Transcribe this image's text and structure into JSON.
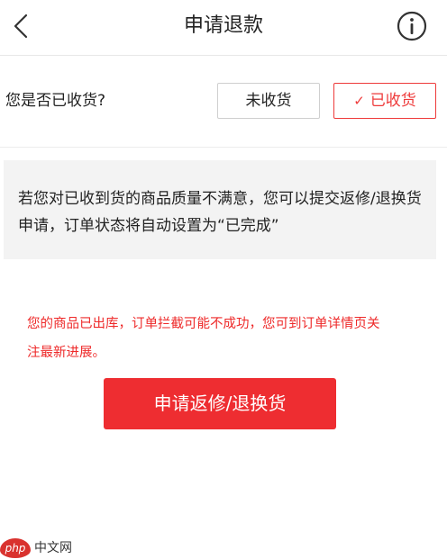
{
  "header": {
    "title": "申请退款"
  },
  "receipt": {
    "question": "您是否已收货?",
    "options": [
      {
        "label": "未收货",
        "selected": false
      },
      {
        "label": "已收货",
        "selected": true
      }
    ]
  },
  "notice": {
    "text": "若您对已收到货的商品质量不满意，您可以提交返修/退换货申请，订单状态将自动设置为“已完成”"
  },
  "warning": {
    "text": "您的商品已出库，订单拦截可能不成功，您可到订单详情页关注最新进展。"
  },
  "action": {
    "button_label": "申请返修/退换货"
  },
  "watermark": {
    "logo_text": "php",
    "site_text": "中文网"
  },
  "colors": {
    "accent": "#ee2d31",
    "warning_text": "#ee2a2a",
    "notice_bg": "#f3f3f3"
  }
}
